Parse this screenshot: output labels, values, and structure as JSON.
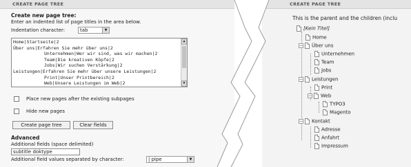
{
  "left": {
    "header": "CREATE PAGE TREE",
    "section_title": "Create new page tree:",
    "instructions": "Enter an indented list of page titles in the area below.",
    "indentation_label": "Indentation character:",
    "indentation_value": "tab",
    "textarea_lines": [
      "Home|Startseite|2",
      "Über uns|Erfahren Sie mehr über uns|2",
      "\tUnternehmen|Wer wir sind, was wir machen|2",
      "\tTeam|Die kreativen Köpfe|2",
      "\tJobs|Wir suchen Verstärkung|2",
      "Leistungen|Erfahren Sie mehr über unsere Leistungen|2",
      "\tPrint|Unser Printbereich|2",
      "\tWeb|Unsere Leistungen im Web|2"
    ],
    "checkbox_place_after": "Place new pages after the existing subpages",
    "checkbox_hide": "Hide new pages",
    "btn_create": "Create page tree",
    "btn_clear": "Clear fields",
    "advanced_title": "Advanced",
    "additional_fields_label": "Additional fields (space delimited)",
    "additional_fields_value": "subtitle doktype",
    "separator_label": "Additional field values separated by character:",
    "separator_value": "| pipe"
  },
  "right": {
    "header": "CREATE PAGE TREE",
    "intro": "This is the parent and the children (inclu",
    "root": "[Kein Titel]",
    "items": [
      {
        "label": "Home"
      },
      {
        "label": "Über uns"
      },
      {
        "label": "Unternehmen"
      },
      {
        "label": "Team"
      },
      {
        "label": "Jobs"
      },
      {
        "label": "Leistungen"
      },
      {
        "label": "Print"
      },
      {
        "label": "Web"
      },
      {
        "label": "TYPO3"
      },
      {
        "label": "Magento"
      },
      {
        "label": "Kontakt"
      },
      {
        "label": "Adresse"
      },
      {
        "label": "Anfahrt"
      },
      {
        "label": "Impressum"
      }
    ]
  },
  "colors": {
    "header_bg": "#e4e4e4",
    "panel_bg": "#f7f7f7",
    "tear_bg": "#ffffff"
  }
}
